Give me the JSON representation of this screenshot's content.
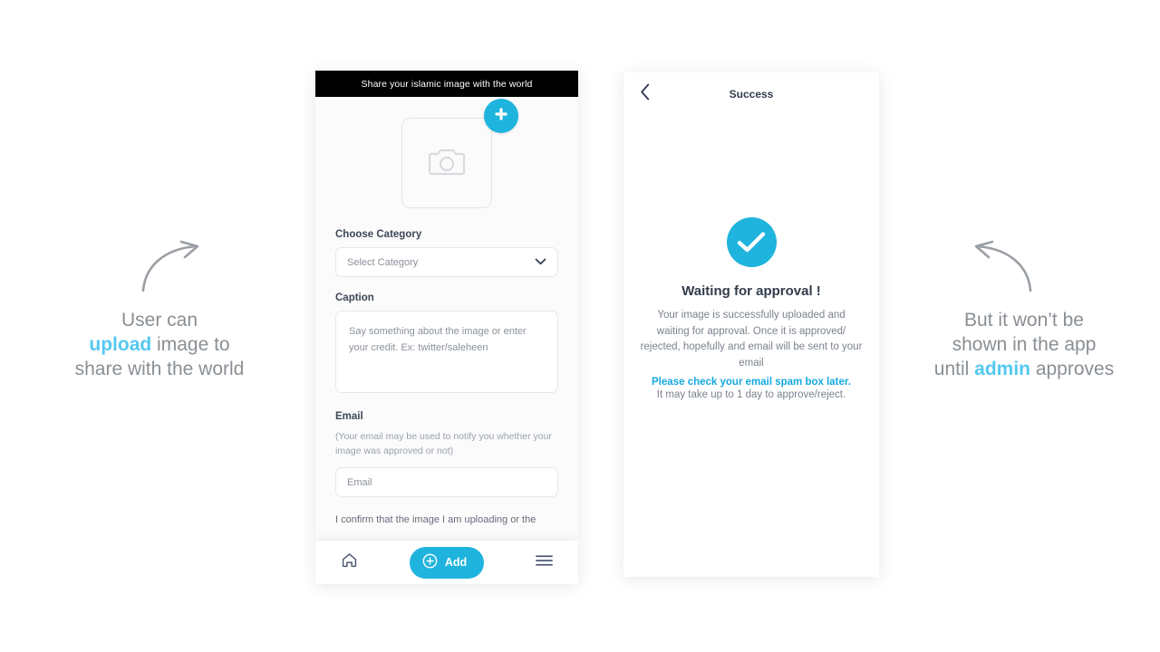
{
  "colors": {
    "accent": "#1fb4dd",
    "accent_light": "#54c8f0",
    "link": "#16a9e0",
    "annotation_text": "#8a8f94",
    "dark_header": "#000000"
  },
  "annotations": {
    "left": {
      "arrow_icon": "curved-arrow-right-icon",
      "line1": "User can",
      "highlight": "upload",
      "line2_rest": " image to",
      "line3": "share with the world"
    },
    "right": {
      "arrow_icon": "curved-arrow-left-icon",
      "line1": "But it won’t be",
      "line2": "shown in the app",
      "line3_pre": "until ",
      "highlight": "admin",
      "line3_post": " approves"
    }
  },
  "upload_screen": {
    "topbar_title": "Share your islamic image with the world",
    "uploader": {
      "placeholder_icon": "camera-icon",
      "add_badge_icon": "plus-icon"
    },
    "category": {
      "label": "Choose Category",
      "selected": "Select Category",
      "chevron_icon": "chevron-down-icon",
      "options": [
        "Select Category"
      ]
    },
    "caption": {
      "label": "Caption",
      "placeholder": "Say something about the image or enter your credit. Ex: twitter/saleheen",
      "value": ""
    },
    "email": {
      "label": "Email",
      "note": "(Your email may be used to notify you whether your image was approved or not)",
      "placeholder": "Email",
      "value": ""
    },
    "confirm_text": "I confirm that the image I am uploading or the",
    "bottom_nav": {
      "home_icon": "home-icon",
      "add_label": "Add",
      "add_icon": "plus-circle-icon",
      "menu_icon": "hamburger-menu-icon"
    }
  },
  "success_screen": {
    "back_icon": "chevron-left-icon",
    "title": "Success",
    "check_icon": "check-circle-icon",
    "heading": "Waiting for approval !",
    "message": "Your image is successfully uploaded and waiting for approval. Once it is approved/ rejected, hopefully and email will be sent to your email",
    "spam_note": "Please check your email spam box later.",
    "eta_note": "It may take up to 1 day to approve/reject."
  }
}
